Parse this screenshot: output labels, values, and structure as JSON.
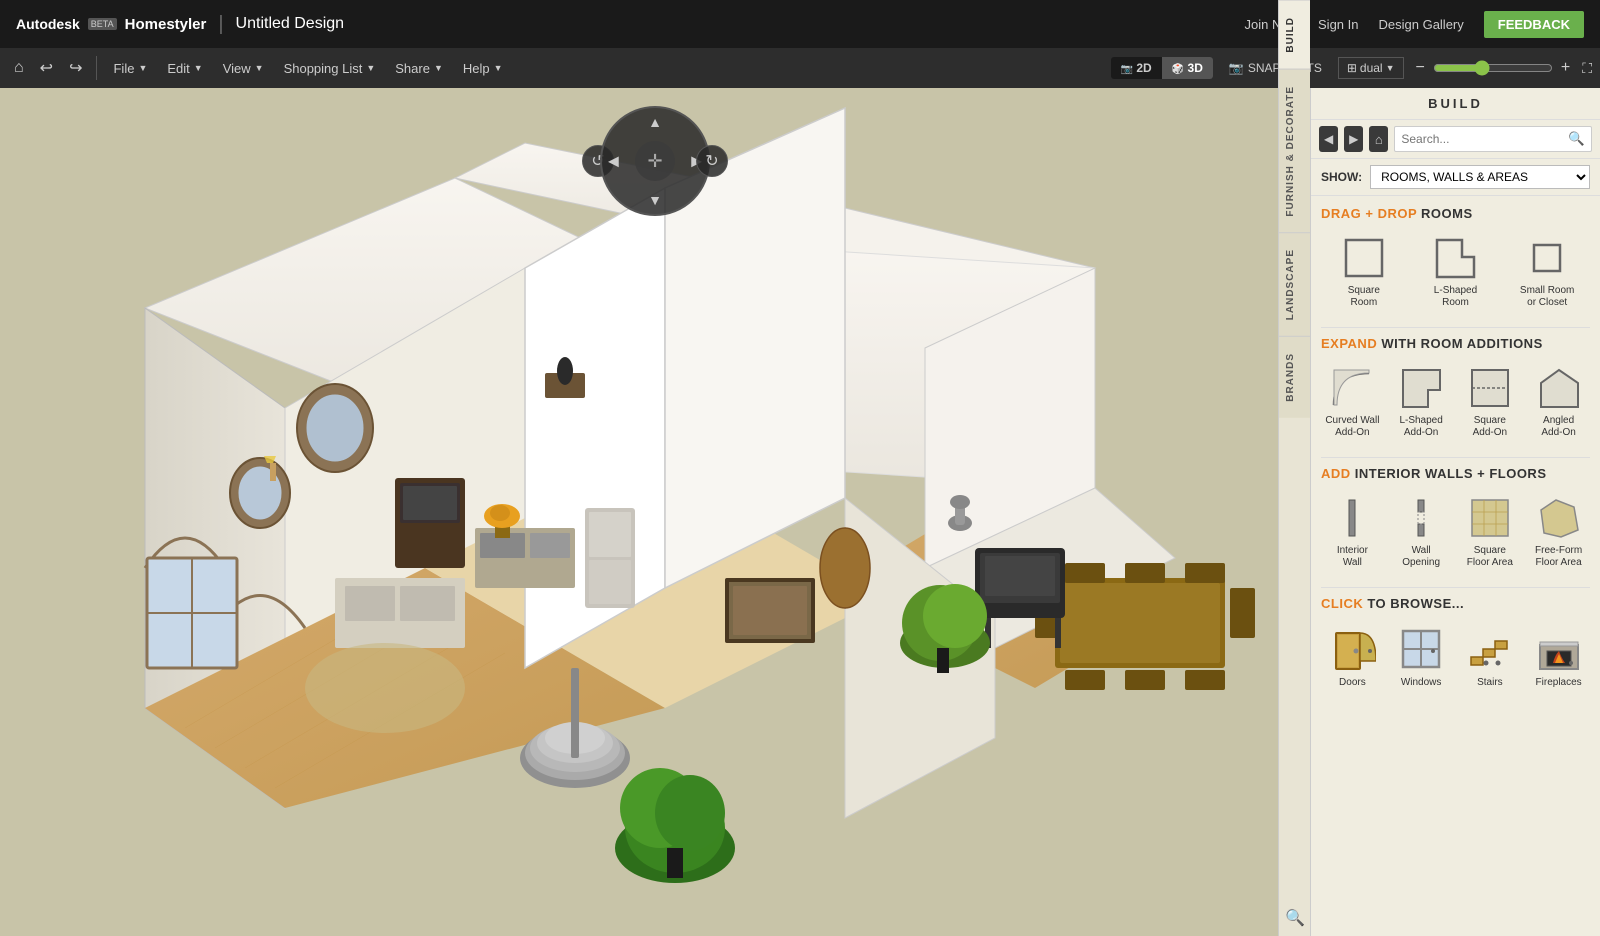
{
  "app": {
    "brand": "Autodesk",
    "product": "Homestyler",
    "beta_label": "BETA",
    "title_separator": "|",
    "design_title": "Untitled Design"
  },
  "top_nav": {
    "join_now": "Join Now",
    "sign_in": "Sign In",
    "design_gallery": "Design Gallery",
    "feedback": "FEEDBACK"
  },
  "toolbar": {
    "home_icon": "⌂",
    "undo_icon": "↩",
    "redo_icon": "↪",
    "file_label": "File",
    "edit_label": "Edit",
    "view_label": "View",
    "shopping_list_label": "Shopping List",
    "share_label": "Share",
    "help_label": "Help",
    "view_2d": "2D",
    "view_3d": "3D",
    "snapshots": "SNAPSHOTS",
    "dual": "dual",
    "zoom_in": "+",
    "zoom_out": "−",
    "fullscreen": "⛶"
  },
  "panel": {
    "build_tab": "BUILD",
    "furnish_decorate_tab": "FURNISH & DECORATE",
    "landscape_tab": "LANDSCAPE",
    "brands_tab": "BRANDS",
    "show_label": "SHOW:",
    "show_option": "ROOMS, WALLS & AREAS",
    "search_placeholder": "Search...",
    "drag_drop_label": "DRAG + DROP",
    "rooms_label": "ROOMS",
    "expand_label": "EXPAND",
    "with_room_label": "WITH ROOM ADDITIONS",
    "add_label": "ADD",
    "interior_walls_label": "INTERIOR WALLS + FLOORS",
    "click_label": "CLICK",
    "to_browse_label": "TO BROWSE...",
    "rooms": [
      {
        "label": "Square\nRoom",
        "shape": "square"
      },
      {
        "label": "L-Shaped\nRoom",
        "shape": "l-shaped"
      },
      {
        "label": "Small Room\nor Closet",
        "shape": "small-room"
      }
    ],
    "additions": [
      {
        "label": "Curved Wall\nAdd-On",
        "shape": "curved-wall"
      },
      {
        "label": "L-Shaped\nAdd-On",
        "shape": "l-shaped-addon"
      },
      {
        "label": "Square\nAdd-On",
        "shape": "square-addon"
      },
      {
        "label": "Angled\nAdd-On",
        "shape": "angled-addon"
      }
    ],
    "interior": [
      {
        "label": "Interior\nWall",
        "shape": "interior-wall"
      },
      {
        "label": "Wall\nOpening",
        "shape": "wall-opening"
      },
      {
        "label": "Square\nFloor Area",
        "shape": "square-floor"
      },
      {
        "label": "Free-Form\nFloor Area",
        "shape": "freeform-floor"
      }
    ],
    "browse": [
      {
        "label": "Doors",
        "shape": "doors"
      },
      {
        "label": "Windows",
        "shape": "windows"
      },
      {
        "label": "Stairs",
        "shape": "stairs"
      },
      {
        "label": "Fireplaces",
        "shape": "fireplaces"
      }
    ]
  },
  "colors": {
    "accent": "#e67e22",
    "header_bg": "#1a1a1a",
    "toolbar_bg": "#2d2d2d",
    "panel_bg": "#f0ede0",
    "active_green": "#6ab04c",
    "nav_dark": "#3a3a3a"
  }
}
